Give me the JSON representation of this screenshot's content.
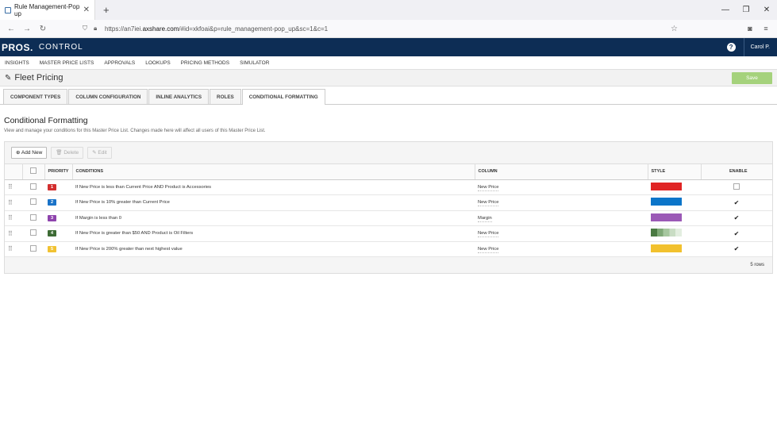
{
  "browser": {
    "tab_title": "Rule Management-Pop up",
    "url_prefix": "https://an7iei.",
    "url_host": "axshare.com",
    "url_suffix": "/#id=xkfoai&p=rule_management-pop_up&sc=1&c=1"
  },
  "app": {
    "logo": "PROS.",
    "product": "CONTROL",
    "user": "Carol P.",
    "help_icon_char": "?"
  },
  "topnav": [
    "INSIGHTS",
    "MASTER PRICE LISTS",
    "APPROVALS",
    "LOOKUPS",
    "PRICING METHODS",
    "SIMULATOR"
  ],
  "page": {
    "title": "Fleet Pricing",
    "save_label": "Save"
  },
  "tabs": [
    "COMPONENT TYPES",
    "COLUMN CONFIGURATION",
    "INLINE ANALYTICS",
    "ROLES",
    "CONDITIONAL FORMATTING"
  ],
  "active_tab": "CONDITIONAL FORMATTING",
  "section": {
    "title": "Conditional Formatting",
    "description": "View and manage your conditions for this Master Price List. Changes made here will affect all users of this Master Price List."
  },
  "toolbar": {
    "add_label": "Add New",
    "delete_label": "Delete",
    "edit_label": "Edit"
  },
  "table": {
    "headers": {
      "priority": "PRIORITY",
      "conditions": "CONDITIONS",
      "column": "COLUMN",
      "style": "STYLE",
      "enable": "ENABLE"
    },
    "rows": [
      {
        "priority": "1",
        "priority_color": "#d32f2f",
        "condition": "If New Price is less than Current Price AND Product is Accessories",
        "column": "New Price",
        "style_color": "#e02424",
        "enabled": false
      },
      {
        "priority": "2",
        "priority_color": "#1a73c8",
        "condition": "If New Price is 10% greater than Current Price",
        "column": "New Price",
        "style_color": "#0b75c9",
        "enabled": true
      },
      {
        "priority": "3",
        "priority_color": "#8e44ad",
        "condition": "If Margin is less than 0",
        "column": "Margin",
        "style_color": "#9b59b6",
        "enabled": true
      },
      {
        "priority": "4",
        "priority_color": "#3d6b35",
        "condition": "If New Price is greater than $50 AND Product is Oil Filters",
        "column": "New Price",
        "style_color": "#5e8f55",
        "enabled": true
      },
      {
        "priority": "5",
        "priority_color": "#f1c232",
        "condition": "If New Price is 200% greater than next highest value",
        "column": "New Price",
        "style_color": "#f2c12e",
        "enabled": true
      }
    ],
    "footer": "5 rows"
  }
}
